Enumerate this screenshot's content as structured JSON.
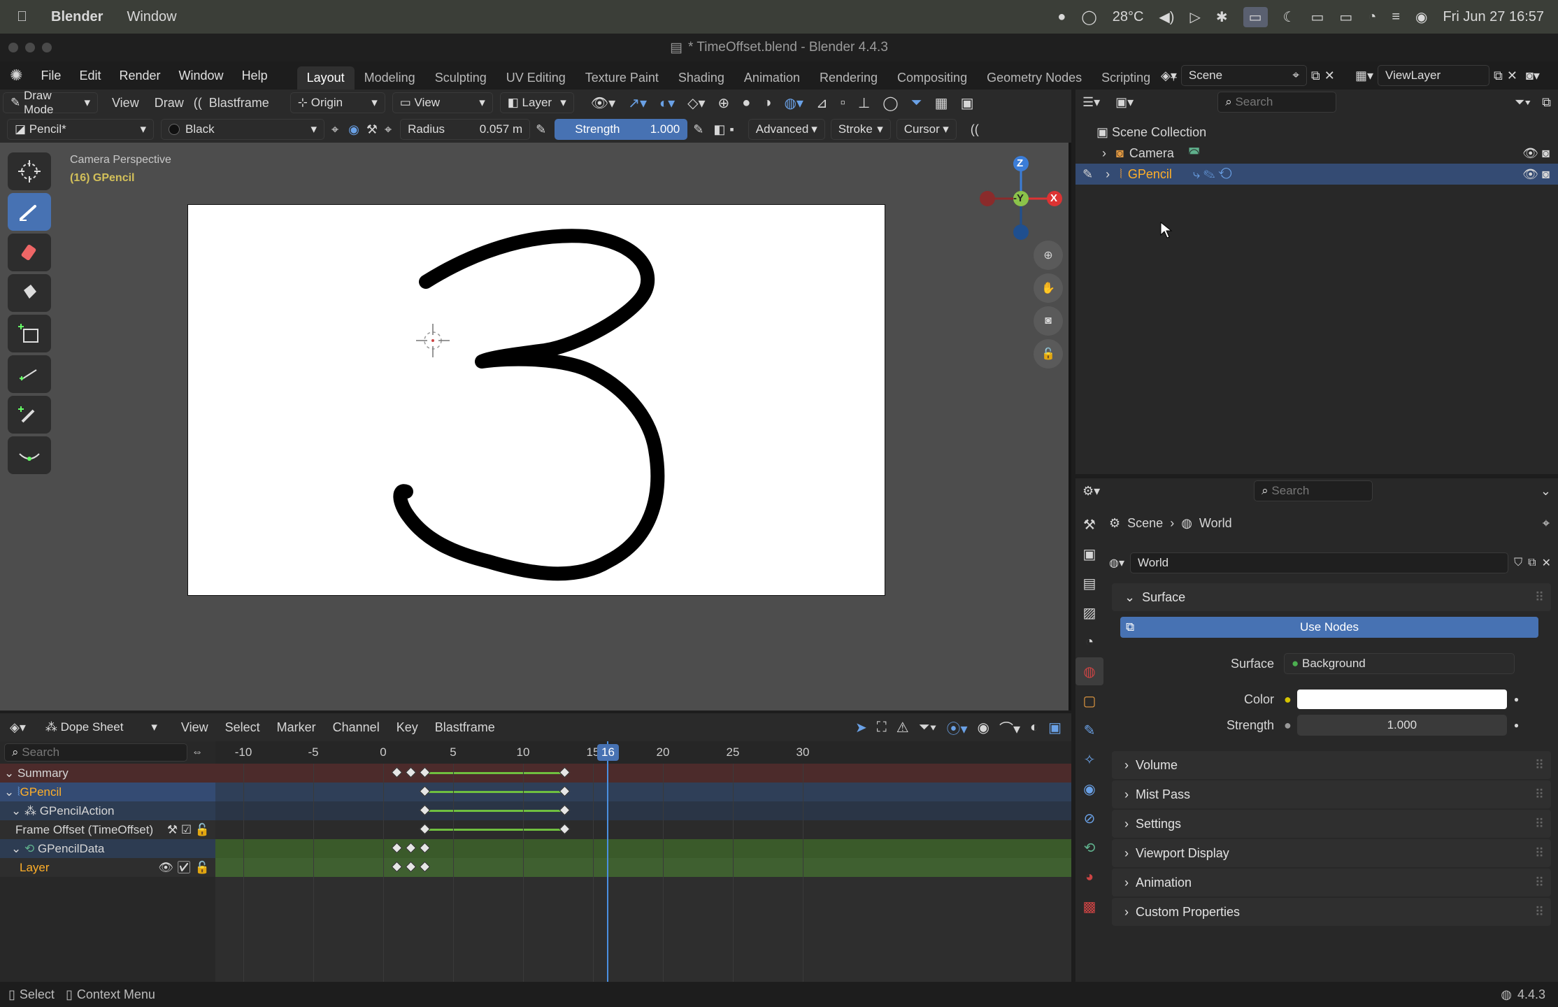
{
  "mac": {
    "app": "Blender",
    "menu_window": "Window",
    "temp": "28°C",
    "datetime": "Fri Jun 27  16:57"
  },
  "window_title": "* TimeOffset.blend - Blender 4.4.3",
  "menus": [
    "File",
    "Edit",
    "Render",
    "Window",
    "Help"
  ],
  "workspaces": [
    "Layout",
    "Modeling",
    "Sculpting",
    "UV Editing",
    "Texture Paint",
    "Shading",
    "Animation",
    "Rendering",
    "Compositing",
    "Geometry Nodes",
    "Scripting"
  ],
  "scene": "Scene",
  "view_layer": "ViewLayer",
  "hdr1": {
    "mode": "Draw Mode",
    "view": "View",
    "draw": "Draw",
    "blastframe": "Blastframe",
    "origin": "Origin",
    "view2": "View",
    "layer": "Layer"
  },
  "hdr2": {
    "brush": "Pencil*",
    "material": "Black",
    "radius_label": "Radius",
    "radius_value": "0.057 m",
    "strength_label": "Strength",
    "strength_value": "1.000",
    "advanced": "Advanced",
    "stroke": "Stroke",
    "cursor": "Cursor"
  },
  "viewport": {
    "perspective": "Camera Perspective",
    "object": "(16) GPencil",
    "axis_z": "Z",
    "axis_y": "-Y",
    "axis_x": "X"
  },
  "outliner": {
    "search_placeholder": "Search",
    "root": "Scene Collection",
    "items": [
      "Camera",
      "GPencil"
    ]
  },
  "props": {
    "search_placeholder": "Search",
    "breadcrumb": [
      "Scene",
      "World"
    ],
    "world_name": "World",
    "surface_panel": "Surface",
    "use_nodes": "Use Nodes",
    "surface_label": "Surface",
    "surface_value": "Background",
    "color_label": "Color",
    "strength_label": "Strength",
    "strength_value": "1.000",
    "color_value": "#ffffff",
    "panels": [
      "Volume",
      "Mist Pass",
      "Settings",
      "Viewport Display",
      "Animation",
      "Custom Properties"
    ]
  },
  "dope": {
    "editor": "Dope Sheet",
    "menus": [
      "View",
      "Select",
      "Marker",
      "Channel",
      "Key",
      "Blastframe"
    ],
    "search_placeholder": "Search",
    "ruler": [
      "-10",
      "-5",
      "0",
      "5",
      "10",
      "15",
      "16",
      "20",
      "25",
      "30"
    ],
    "current_frame": 16,
    "channels": [
      "Summary",
      "GPencil",
      "GPencilAction",
      "Frame Offset (TimeOffset)",
      "GPencilData",
      "Layer"
    ],
    "keyframes": [
      [
        1,
        2,
        3,
        13
      ],
      [
        3,
        13
      ],
      [
        3,
        13
      ],
      [
        3,
        13
      ],
      [
        1,
        2,
        3
      ],
      [
        1,
        2,
        3
      ]
    ]
  },
  "status": {
    "select": "Select",
    "context": "Context Menu",
    "version": "4.4.3"
  },
  "colors": {
    "accent": "#4772b3",
    "active_orange": "#ffaf29",
    "keyframe_line": "#6fbf3f"
  }
}
